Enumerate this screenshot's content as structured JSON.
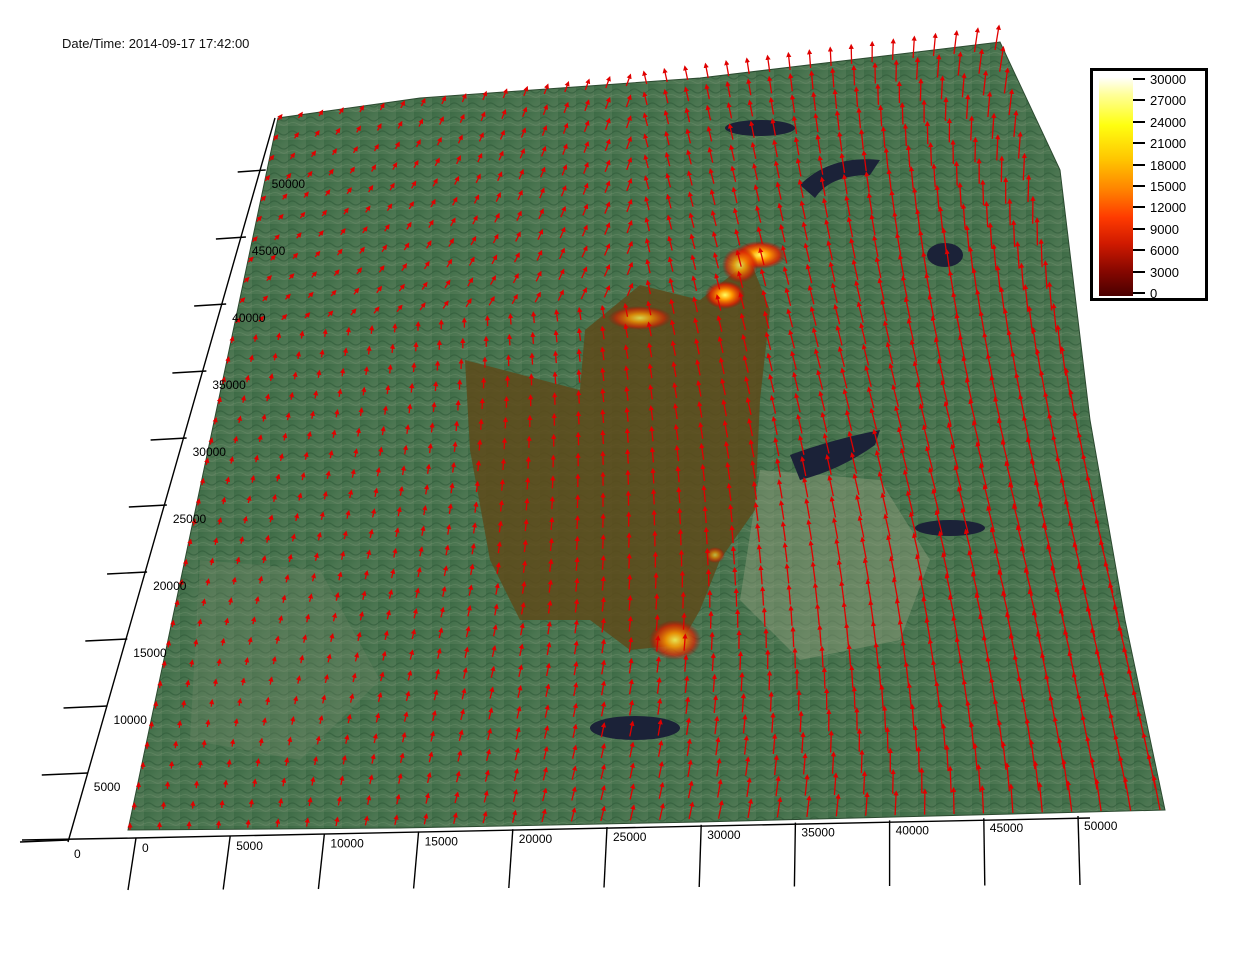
{
  "header": {
    "datetime": "Date/Time: 2014-09-17 17:42:00"
  },
  "colorbar": {
    "labels": [
      "30000",
      "27000",
      "24000",
      "21000",
      "18000",
      "15000",
      "12000",
      "9000",
      "6000",
      "3000",
      "0"
    ],
    "min": 0,
    "max": 30000
  },
  "axes": {
    "x_ticks": [
      "0",
      "5000",
      "10000",
      "15000",
      "20000",
      "25000",
      "30000",
      "35000",
      "40000",
      "45000",
      "50000"
    ],
    "y_ticks": [
      "0",
      "5000",
      "10000",
      "15000",
      "20000",
      "25000",
      "30000",
      "35000",
      "40000",
      "45000",
      "50000"
    ]
  },
  "colors": {
    "terrain": "#3e6a44",
    "burn_area": "#5e4a1a",
    "vector": "#e00000",
    "water": "#1b2238"
  }
}
